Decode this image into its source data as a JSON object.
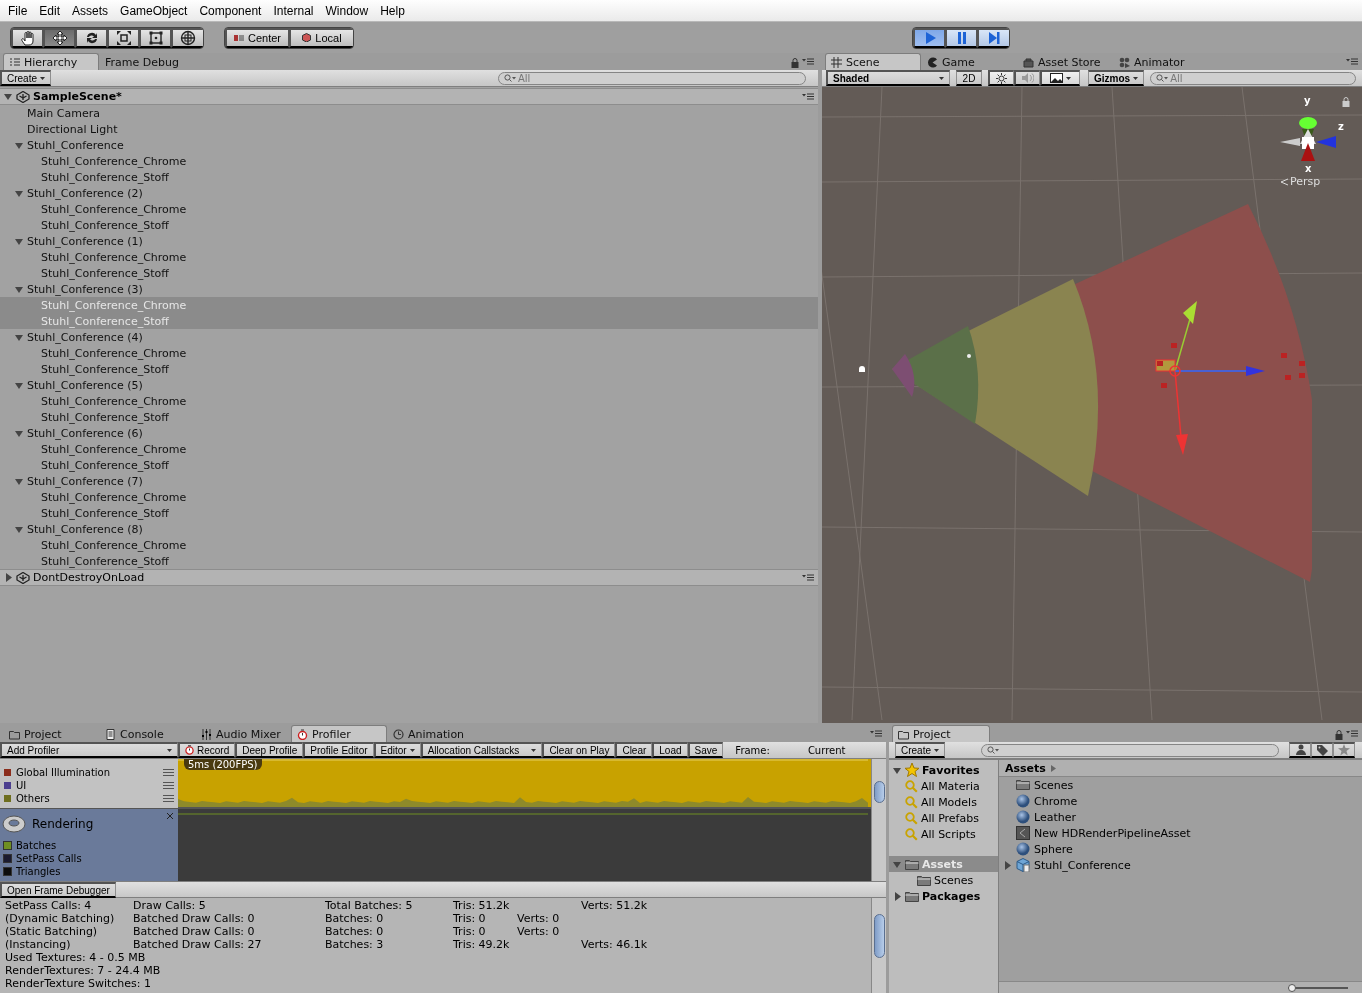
{
  "menu": [
    "File",
    "Edit",
    "Assets",
    "GameObject",
    "Component",
    "Internal",
    "Window",
    "Help"
  ],
  "tools": [
    {
      "kind": "hand",
      "selected": false
    },
    {
      "kind": "move",
      "selected": true
    },
    {
      "kind": "rotate",
      "selected": false
    },
    {
      "kind": "scale",
      "selected": false
    },
    {
      "kind": "rect",
      "selected": false
    },
    {
      "kind": "transform",
      "selected": false
    }
  ],
  "pivot": [
    {
      "kind": "pivot",
      "label": "Center"
    },
    {
      "kind": "space",
      "label": "Local"
    }
  ],
  "play_controls": [
    {
      "kind": "play",
      "active": true
    },
    {
      "kind": "pause",
      "active": false
    },
    {
      "kind": "step",
      "active": false
    }
  ],
  "hierarchy": {
    "tabs": [
      {
        "label": "Hierarchy",
        "kind": "hierarchy",
        "selected": true
      },
      {
        "label": "Frame Debug",
        "kind": "plain",
        "selected": false
      }
    ],
    "create": "Create",
    "search_placeholder": "All",
    "scenes": [
      {
        "name": "SampleScene*",
        "active": true,
        "expanded": true,
        "children": [
          {
            "name": "Main Camera",
            "selected": false
          },
          {
            "name": "Directional Light",
            "selected": false
          },
          {
            "name": "Stuhl_Conference",
            "expanded": true,
            "selected": false,
            "children": [
              {
                "name": "Stuhl_Conference_Chrome",
                "selected": false
              },
              {
                "name": "Stuhl_Conference_Stoff",
                "selected": false
              }
            ]
          },
          {
            "name": "Stuhl_Conference (2)",
            "expanded": true,
            "selected": false,
            "children": [
              {
                "name": "Stuhl_Conference_Chrome",
                "selected": false
              },
              {
                "name": "Stuhl_Conference_Stoff",
                "selected": false
              }
            ]
          },
          {
            "name": "Stuhl_Conference (1)",
            "expanded": true,
            "selected": false,
            "children": [
              {
                "name": "Stuhl_Conference_Chrome",
                "selected": false
              },
              {
                "name": "Stuhl_Conference_Stoff",
                "selected": false
              }
            ]
          },
          {
            "name": "Stuhl_Conference (3)",
            "expanded": true,
            "selected": false,
            "children": [
              {
                "name": "Stuhl_Conference_Chrome",
                "selected": true
              },
              {
                "name": "Stuhl_Conference_Stoff",
                "selected": true
              }
            ]
          },
          {
            "name": "Stuhl_Conference (4)",
            "expanded": true,
            "selected": false,
            "children": [
              {
                "name": "Stuhl_Conference_Chrome",
                "selected": false
              },
              {
                "name": "Stuhl_Conference_Stoff",
                "selected": false
              }
            ]
          },
          {
            "name": "Stuhl_Conference (5)",
            "expanded": true,
            "selected": false,
            "children": [
              {
                "name": "Stuhl_Conference_Chrome",
                "selected": false
              },
              {
                "name": "Stuhl_Conference_Stoff",
                "selected": false
              }
            ]
          },
          {
            "name": "Stuhl_Conference (6)",
            "expanded": true,
            "selected": false,
            "children": [
              {
                "name": "Stuhl_Conference_Chrome",
                "selected": false
              },
              {
                "name": "Stuhl_Conference_Stoff",
                "selected": false
              }
            ]
          },
          {
            "name": "Stuhl_Conference (7)",
            "expanded": true,
            "selected": false,
            "children": [
              {
                "name": "Stuhl_Conference_Chrome",
                "selected": false
              },
              {
                "name": "Stuhl_Conference_Stoff",
                "selected": false
              }
            ]
          },
          {
            "name": "Stuhl_Conference (8)",
            "expanded": true,
            "selected": false,
            "children": [
              {
                "name": "Stuhl_Conference_Chrome",
                "selected": false
              },
              {
                "name": "Stuhl_Conference_Stoff",
                "selected": false
              }
            ]
          }
        ]
      },
      {
        "name": "DontDestroyOnLoad",
        "active": false,
        "expanded": false
      }
    ]
  },
  "scene_view": {
    "tabs": [
      {
        "label": "Scene",
        "kind": "scene",
        "selected": true
      },
      {
        "label": "Game",
        "kind": "game",
        "selected": false
      },
      {
        "label": "Asset Store",
        "kind": "store",
        "selected": false
      },
      {
        "label": "Animator",
        "kind": "animator",
        "selected": false
      }
    ],
    "shading": "Shaded",
    "mode_2d": {
      "label": "2D",
      "on": false
    },
    "lighting_on": true,
    "audio_on": false,
    "effects_on": true,
    "gizmos": "Gizmos",
    "search_placeholder": "All",
    "axis_labels": {
      "y": "y",
      "z": "z",
      "x": "x"
    },
    "projection": "Persp"
  },
  "bottom_tabs": [
    {
      "label": "Project",
      "kind": "project",
      "selected": false
    },
    {
      "label": "Console",
      "kind": "console",
      "selected": false
    },
    {
      "label": "Audio Mixer",
      "kind": "mixer",
      "selected": false
    },
    {
      "label": "Profiler",
      "kind": "profiler",
      "selected": true
    },
    {
      "label": "Animation",
      "kind": "animation",
      "selected": false
    }
  ],
  "profiler": {
    "add_profiler": "Add Profiler",
    "buttons": [
      {
        "kind": "record",
        "label": "Record"
      },
      {
        "kind": "button",
        "label": "Deep Profile"
      },
      {
        "kind": "button",
        "label": "Profile Editor"
      },
      {
        "kind": "dropdown",
        "label": "Editor"
      },
      {
        "kind": "dropdown",
        "label": "Allocation Callstacks"
      },
      {
        "kind": "button",
        "label": "Clear on Play"
      },
      {
        "kind": "button",
        "label": "Clear"
      },
      {
        "kind": "button",
        "label": "Load"
      },
      {
        "kind": "button",
        "label": "Save"
      }
    ],
    "frame_label": "Frame:",
    "frame_value": "Current",
    "cpu_legend": [
      {
        "label": "Global Illumination",
        "color": "#8b2d1c"
      },
      {
        "label": "UI",
        "color": "#4c3f8f"
      },
      {
        "label": "Others",
        "color": "#6e6e1e"
      }
    ],
    "rendering": {
      "title": "Rendering",
      "legend": [
        {
          "label": "Batches",
          "color": "#6f8f22"
        },
        {
          "label": "SetPass Calls",
          "color": "#1b1b2f"
        },
        {
          "label": "Triangles",
          "color": "#0d0d0d"
        }
      ]
    },
    "graph_label": "5ms (200FPS)",
    "open_frame_debugger": "Open Frame Debugger",
    "stats": [
      {
        "column_1": "SetPass Calls: 4",
        "column_2": "Draw Calls: 5",
        "column_3": "Total Batches: 5",
        "column_4": "Tris: 51.2k",
        "column_6": "Verts: 51.2k"
      },
      {
        "column_1": "(Dynamic Batching)",
        "column_2": "Batched Draw Calls: 0",
        "column_3": "Batches: 0",
        "column_4": "Tris: 0",
        "column_5": "Verts: 0"
      },
      {
        "column_1": "(Static Batching)",
        "column_2": "Batched Draw Calls: 0",
        "column_3": "Batches: 0",
        "column_4": "Tris: 0",
        "column_5": "Verts: 0"
      },
      {
        "column_1": "(Instancing)",
        "column_2": "Batched Draw Calls: 27",
        "column_3": "Batches: 3",
        "column_4": "Tris: 49.2k",
        "column_6": "Verts: 46.1k"
      },
      {
        "column_1": "Used Textures: 4 - 0.5 MB"
      },
      {
        "column_1": "RenderTextures: 7 - 24.4 MB"
      },
      {
        "column_1": "RenderTexture Switches: 1"
      }
    ]
  },
  "project": {
    "tab": "Project",
    "create": "Create",
    "favorites": {
      "label": "Favorites",
      "expanded": true,
      "children": [
        {
          "label": "All Materia"
        },
        {
          "label": "All Models"
        },
        {
          "label": "All Prefabs"
        },
        {
          "label": "All Scripts"
        }
      ]
    },
    "folders": [
      {
        "label": "Assets",
        "expanded": true,
        "selected": true,
        "children": [
          {
            "label": "Scenes",
            "selected": false
          }
        ]
      },
      {
        "label": "Packages",
        "expanded": false,
        "selected": false
      }
    ],
    "breadcrumb": "Assets",
    "zoom_slider": {
      "level": 0
    },
    "items": [
      {
        "kind": "folder",
        "label": "Scenes"
      },
      {
        "kind": "material",
        "label": "Chrome"
      },
      {
        "kind": "material",
        "label": "Leather"
      },
      {
        "kind": "asset",
        "label": "New HDRenderPipelineAsset"
      },
      {
        "kind": "material",
        "label": "Sphere"
      },
      {
        "kind": "prefab",
        "label": "Stuhl_Conference",
        "expanded": false
      }
    ]
  }
}
